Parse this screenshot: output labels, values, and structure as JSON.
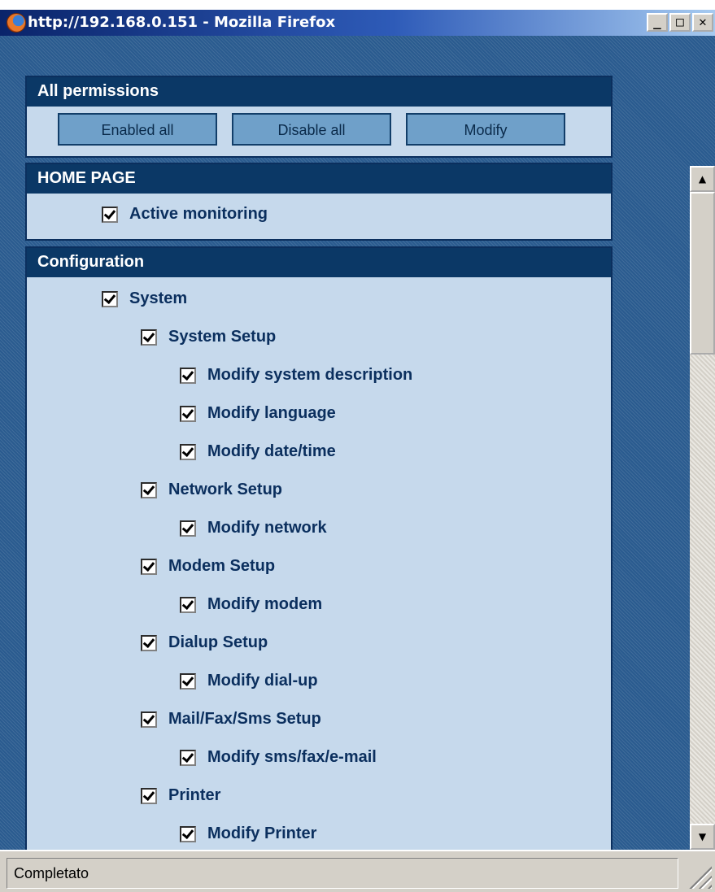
{
  "window": {
    "title": "http://192.168.0.151 - Mozilla Firefox",
    "min_glyph": "_",
    "max_glyph": "□",
    "close_glyph": "✕"
  },
  "panels": {
    "all": {
      "header": "All permissions",
      "buttons": {
        "enable": "Enabled all",
        "disable": "Disable all",
        "modify": "Modify"
      }
    },
    "home": {
      "header": "HOME PAGE",
      "items": [
        {
          "label": "Active monitoring",
          "checked": true
        }
      ]
    },
    "config": {
      "header": "Configuration",
      "items": [
        {
          "label": "System",
          "checked": true
        },
        {
          "label": "System Setup",
          "checked": true
        },
        {
          "label": "Modify system description",
          "checked": true
        },
        {
          "label": "Modify language",
          "checked": true
        },
        {
          "label": "Modify date/time",
          "checked": true
        },
        {
          "label": "Network Setup",
          "checked": true
        },
        {
          "label": "Modify network",
          "checked": true
        },
        {
          "label": "Modem Setup",
          "checked": true
        },
        {
          "label": "Modify modem",
          "checked": true
        },
        {
          "label": "Dialup Setup",
          "checked": true
        },
        {
          "label": "Modify dial-up",
          "checked": true
        },
        {
          "label": "Mail/Fax/Sms Setup",
          "checked": true
        },
        {
          "label": "Modify sms/fax/e-mail",
          "checked": true
        },
        {
          "label": "Printer",
          "checked": true
        },
        {
          "label": "Modify Printer",
          "checked": true
        }
      ]
    }
  },
  "scrollbar": {
    "up_glyph": "▲",
    "down_glyph": "▼"
  },
  "statusbar": {
    "text": "Completato"
  },
  "colors": {
    "background": "#2a5b8f",
    "panel_header": "#0b3866",
    "panel_body": "#c6d9ec",
    "text": "#0b2f5e"
  }
}
